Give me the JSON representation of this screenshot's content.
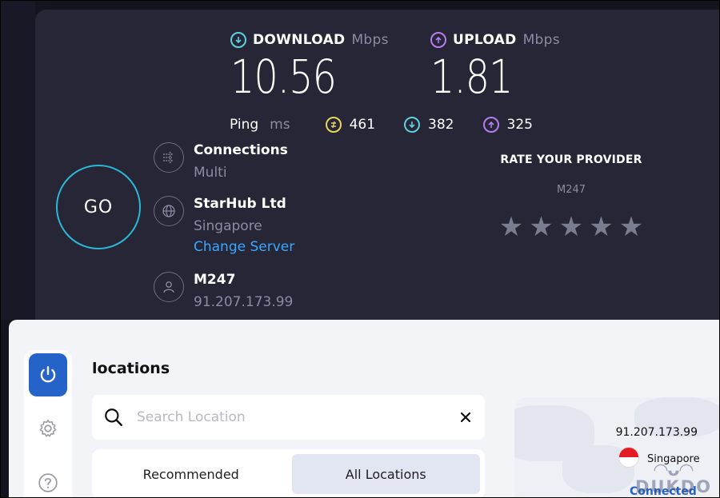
{
  "speedtest": {
    "download": {
      "label": "DOWNLOAD",
      "unit": "Mbps",
      "value": "10.56",
      "color": "#5fd0e0"
    },
    "upload": {
      "label": "UPLOAD",
      "unit": "Mbps",
      "value": "1.81",
      "color": "#b57cf0"
    },
    "ping": {
      "label": "Ping",
      "unit": "ms",
      "idle": "461",
      "download": "382",
      "upload": "325",
      "idle_color": "#e8d65a"
    },
    "go_label": "GO",
    "connections": {
      "title": "Connections",
      "value": "Multi"
    },
    "server": {
      "title": "StarHub Ltd",
      "location": "Singapore",
      "change_label": "Change Server"
    },
    "client": {
      "title": "M247",
      "ip": "91.207.173.99"
    },
    "rate": {
      "title": "RATE YOUR PROVIDER",
      "isp": "M247",
      "stars": 5
    }
  },
  "vpn": {
    "title": "locations",
    "search": {
      "placeholder": "Search Location",
      "value": ""
    },
    "tabs": [
      {
        "label": "Recommended",
        "active": false
      },
      {
        "label": "All Locations",
        "active": true
      }
    ],
    "map": {
      "ip": "91.207.173.99",
      "country": "Singapore",
      "status": "Connected"
    },
    "accent": "#2563c9"
  },
  "watermark": {
    "text": "DUKDO"
  }
}
